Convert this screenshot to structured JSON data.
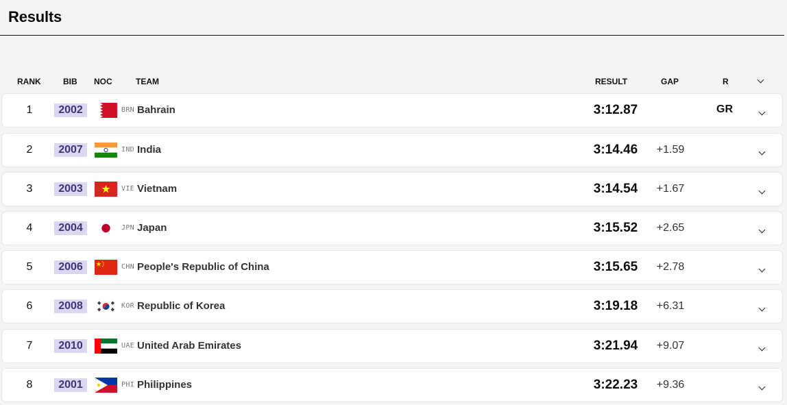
{
  "page": {
    "title": "Results"
  },
  "columns": {
    "rank": "RANK",
    "bib": "BIB",
    "noc": "NOC",
    "team": "TEAM",
    "result": "RESULT",
    "gap": "GAP",
    "r": "R"
  },
  "rows": [
    {
      "rank": "1",
      "bib": "2002",
      "code": "BRN",
      "team": "Bahrain",
      "result": "3:12.87",
      "gap": "",
      "r": "GR",
      "flag": "bahrain-flag-icon"
    },
    {
      "rank": "2",
      "bib": "2007",
      "code": "IND",
      "team": "India",
      "result": "3:14.46",
      "gap": "+1.59",
      "r": "",
      "flag": "india-flag-icon"
    },
    {
      "rank": "3",
      "bib": "2003",
      "code": "VIE",
      "team": "Vietnam",
      "result": "3:14.54",
      "gap": "+1.67",
      "r": "",
      "flag": "vietnam-flag-icon"
    },
    {
      "rank": "4",
      "bib": "2004",
      "code": "JPN",
      "team": "Japan",
      "result": "3:15.52",
      "gap": "+2.65",
      "r": "",
      "flag": "japan-flag-icon"
    },
    {
      "rank": "5",
      "bib": "2006",
      "code": "CHN",
      "team": "People's Republic of China",
      "result": "3:15.65",
      "gap": "+2.78",
      "r": "",
      "flag": "china-flag-icon"
    },
    {
      "rank": "6",
      "bib": "2008",
      "code": "KOR",
      "team": "Republic of Korea",
      "result": "3:19.18",
      "gap": "+6.31",
      "r": "",
      "flag": "korea-flag-icon"
    },
    {
      "rank": "7",
      "bib": "2010",
      "code": "UAE",
      "team": "United Arab Emirates",
      "result": "3:21.94",
      "gap": "+9.07",
      "r": "",
      "flag": "uae-flag-icon"
    },
    {
      "rank": "8",
      "bib": "2001",
      "code": "PHI",
      "team": "Philippines",
      "result": "3:22.23",
      "gap": "+9.36",
      "r": "",
      "flag": "philippines-flag-icon"
    }
  ],
  "colors": {
    "bib_bg": "#dcd7f1",
    "bib_text": "#3c3674",
    "row_bg": "#ffffff",
    "page_bg": "#f4f4f4"
  }
}
